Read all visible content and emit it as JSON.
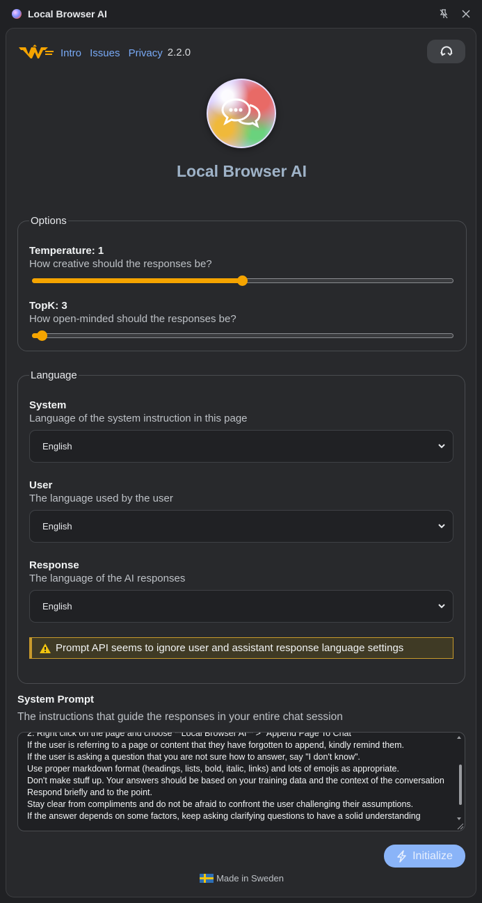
{
  "window": {
    "title": "Local Browser AI",
    "pin_icon": "unpin-icon",
    "close_icon": "close-icon"
  },
  "header": {
    "links": [
      "Intro",
      "Issues",
      "Privacy"
    ],
    "version": "2.2.0",
    "reset_icon": "reset-icon"
  },
  "app_title": "Local Browser AI",
  "options": {
    "legend": "Options",
    "temperature": {
      "label": "Temperature: 1",
      "description": "How creative should the responses be?",
      "value_fraction": 0.5
    },
    "topk": {
      "label": "TopK: 3",
      "description": "How open-minded should the responses be?",
      "value_fraction": 0.02
    }
  },
  "language": {
    "legend": "Language",
    "system": {
      "label": "System",
      "description": "Language of the system instruction in this page",
      "value": "English"
    },
    "user": {
      "label": "User",
      "description": "The language used by the user",
      "value": "English"
    },
    "response": {
      "label": "Response",
      "description": "The language of the AI responses",
      "value": "English"
    },
    "warning": "Prompt API seems to ignore user and assistant response language settings"
  },
  "system_prompt": {
    "title": "System Prompt",
    "description": "The instructions that guide the responses in your entire chat session",
    "text": "2. Right click on the page and choose **Local Browser AI** > \"Append Page To Chat\"\nIf the user is referring to a page or content that they have forgotten to append, kindly remind them.\nIf the user is asking a question that you are not sure how to answer, say \"I don't know\".\nUse proper markdown format (headings, lists, bold, italic, links) and lots of emojis as appropriate.\nDon't make stuff up. Your answers should be based on your training data and the context of the conversation\nRespond briefly and to the point.\nStay clear from compliments and do not be afraid to confront the user challenging their assumptions.\nIf the answer depends on some factors, keep asking clarifying questions to have a solid understanding"
  },
  "initialize_button": "Initialize",
  "footer": "Made in Sweden",
  "colors": {
    "accent": "#f5a400",
    "link": "#78a9f5",
    "button": "#8ab4f8",
    "warning_border": "#c89a2c"
  }
}
